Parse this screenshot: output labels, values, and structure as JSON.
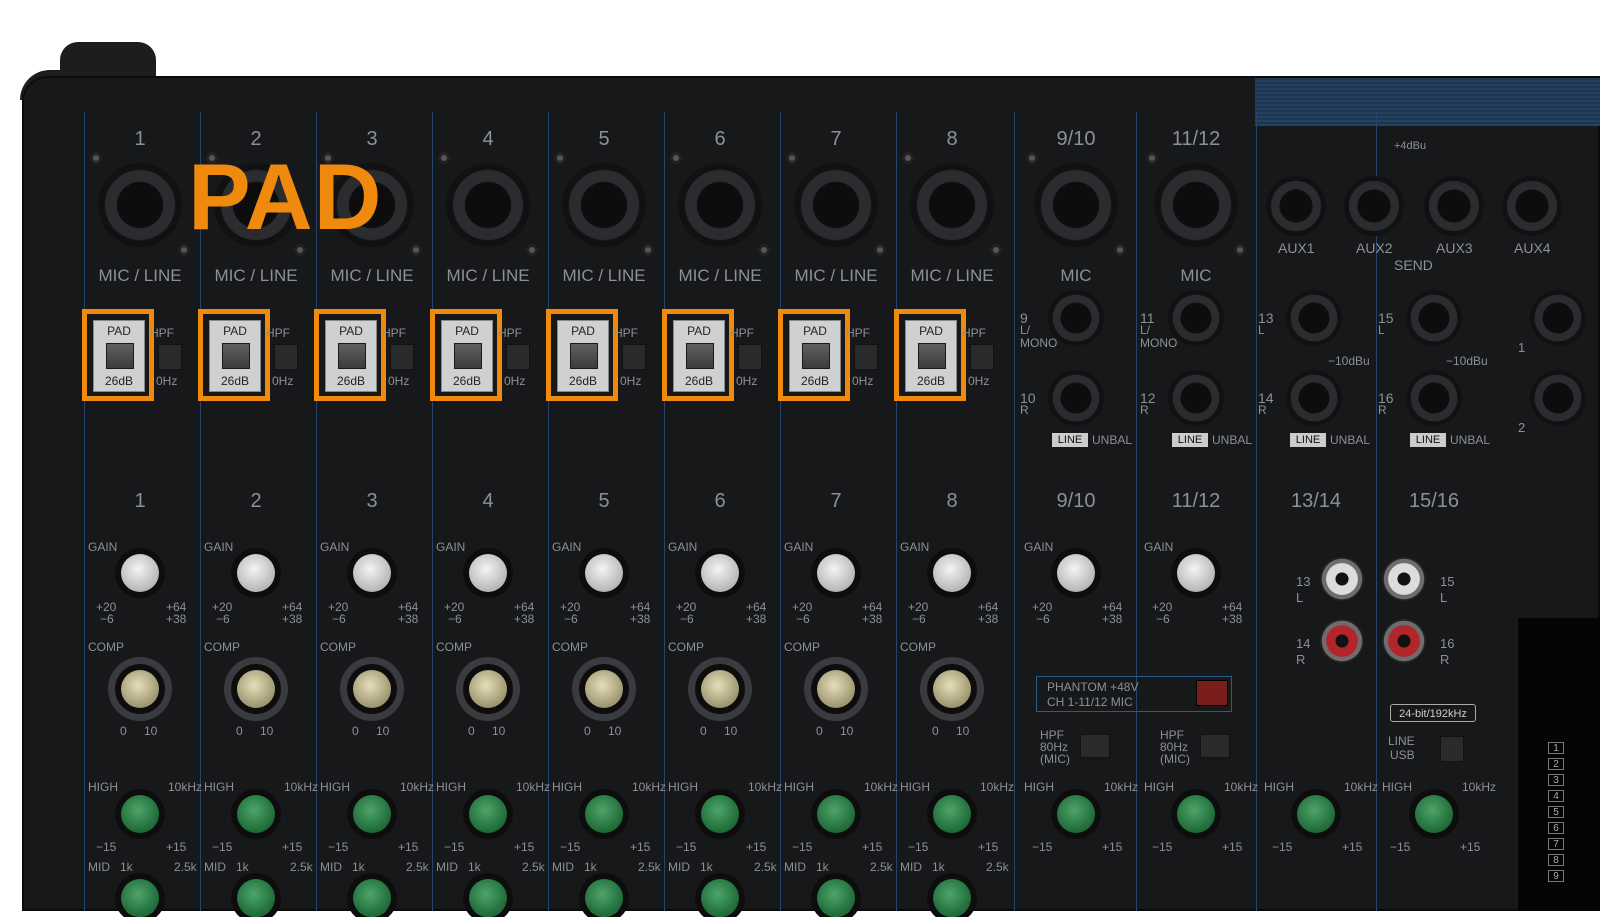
{
  "title_overlay": "PAD",
  "channels_top": [
    "1",
    "2",
    "3",
    "4",
    "5",
    "6",
    "7",
    "8",
    "9/10",
    "11/12"
  ],
  "channels_bottom": [
    "1",
    "2",
    "3",
    "4",
    "5",
    "6",
    "7",
    "8",
    "9/10",
    "11/12",
    "13/14",
    "15/16"
  ],
  "mic_line_label": "MIC / LINE",
  "mic_label": "MIC",
  "pad_switch": {
    "top": "PAD",
    "bottom": "26dB"
  },
  "hpf_label": "HPF",
  "hpf_freq_fragment": "0Hz",
  "send_section": {
    "level": "+4dBu",
    "title": "SEND",
    "aux": [
      "AUX1",
      "AUX2",
      "AUX3",
      "AUX4"
    ]
  },
  "line_inputs": {
    "ch9": "9",
    "ch9_sub": "L/\nMONO",
    "ch10": "10",
    "ch10_sub": "R",
    "ch11": "11",
    "ch11_sub": "L/\nMONO",
    "ch12": "12",
    "ch12_sub": "R",
    "ch13": "13",
    "ch13_sub": "L",
    "ch14": "14",
    "ch14_sub": "R",
    "ch15": "15",
    "ch15_sub": "L",
    "ch16": "16",
    "ch16_sub": "R",
    "right1": "1",
    "right2": "2",
    "line_badge": "LINE",
    "unbal": "UNBAL",
    "level": "−10dBu"
  },
  "gain": {
    "label": "GAIN",
    "min": "+20",
    "max": "+64",
    "min2": "−6",
    "max2": "+38"
  },
  "comp": {
    "label": "COMP",
    "min": "0",
    "max": "10"
  },
  "high": {
    "label": "HIGH",
    "freq": "10kHz",
    "min": "−15",
    "max": "+15"
  },
  "mid": {
    "label": "MID",
    "f1": "1k",
    "f2": "2.5k"
  },
  "phantom": {
    "line1": "PHANTOM  +48V",
    "line2": "CH 1-11/12 MIC"
  },
  "hpf_mic": {
    "line1": "HPF",
    "line2": "80Hz",
    "line3": "(MIC)"
  },
  "rca": {
    "l1": "13",
    "l1s": "L",
    "l2": "15",
    "l2s": "L",
    "r1": "14",
    "r1s": "R",
    "r2": "16",
    "r2s": "R"
  },
  "usb": {
    "badge": "24-bit/192kHz",
    "line": "LINE",
    "usb": "USB"
  },
  "meter_numbers": [
    "1",
    "2",
    "3",
    "4",
    "5",
    "6",
    "7",
    "8",
    "9"
  ],
  "colors": {
    "accent": "#f08a0f",
    "panel": "#17181a",
    "strip_line": "#24466c",
    "eq_knob": "#1d6a37"
  }
}
